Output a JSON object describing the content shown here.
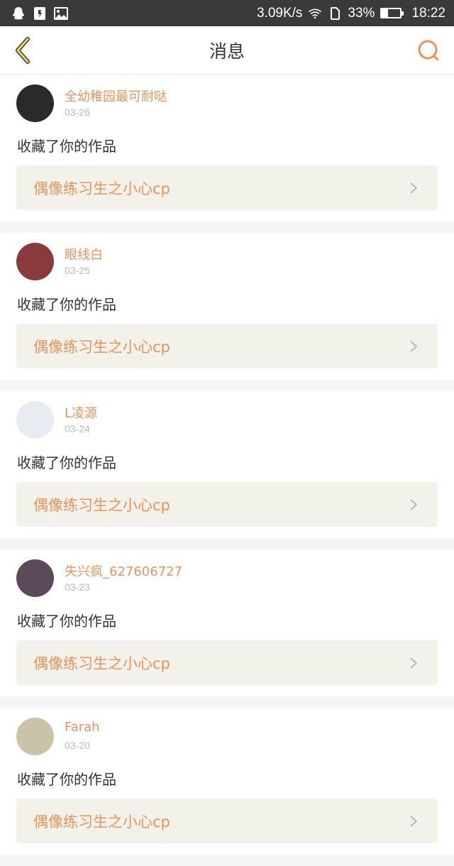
{
  "status_bar": {
    "speed": "3.09K/s",
    "battery": "33%",
    "battery_level": 0.33,
    "time": "18:22"
  },
  "header": {
    "title": "消息"
  },
  "colors": {
    "accent": "#e8935a",
    "status_bar": "#3a3a3a",
    "card_bg": "#f3f2ea"
  },
  "messages": [
    {
      "user": "全幼稚园最可耐哒",
      "date": "03-26",
      "action": "收藏了你的作品",
      "work": "偶像练习生之小心cp",
      "avatar_color": "#2a2a2a"
    },
    {
      "user": "眼线白",
      "date": "03-25",
      "action": "收藏了你的作品",
      "work": "偶像练习生之小心cp",
      "avatar_color": "#8a3a3a"
    },
    {
      "user": "L凌源",
      "date": "03-24",
      "action": "收藏了你的作品",
      "work": "偶像练习生之小心cp",
      "avatar_color": "#e8ecf2"
    },
    {
      "user": "失兴疯_627606727",
      "date": "03-23",
      "action": "收藏了你的作品",
      "work": "偶像练习生之小心cp",
      "avatar_color": "#5a4a5a"
    },
    {
      "user": "Farah",
      "date": "03-20",
      "action": "收藏了你的作品",
      "work": "偶像练习生之小心cp",
      "avatar_color": "#c9c4a8"
    }
  ]
}
